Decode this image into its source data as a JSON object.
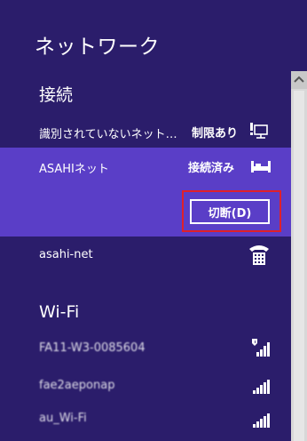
{
  "title": "ネットワーク",
  "sections": {
    "connections": "接続",
    "wifi": "Wi-Fi"
  },
  "connections": [
    {
      "name": "識別されていないネット…",
      "status": "制限あり"
    },
    {
      "name": "ASAHIネット",
      "status": "接続済み"
    },
    {
      "name": "asahi-net",
      "status": ""
    }
  ],
  "disconnect_button": "切断(D)",
  "wifi": [
    {
      "name": "FA11-W3-0085604",
      "secured": true
    },
    {
      "name": "fae2aeponap",
      "secured": false
    },
    {
      "name": "au_Wi-Fi",
      "secured": false
    }
  ],
  "colors": {
    "background": "#2b1d6b",
    "selected": "#5a3ec7",
    "focus": "#e0202a"
  }
}
